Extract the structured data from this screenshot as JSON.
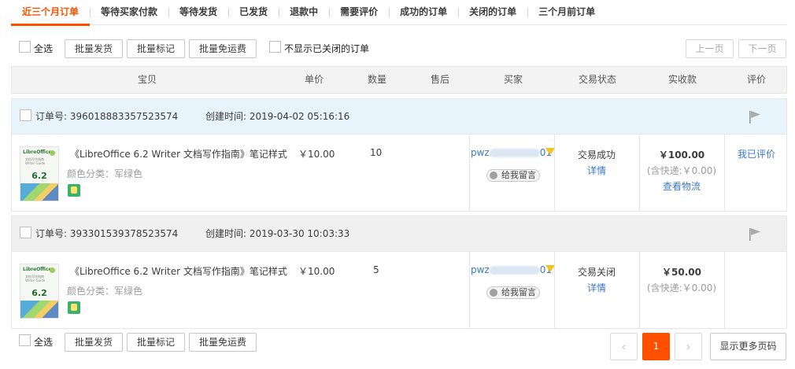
{
  "tabs": [
    {
      "label": "近三个月订单",
      "active": true
    },
    {
      "label": "等待买家付款"
    },
    {
      "label": "等待发货"
    },
    {
      "label": "已发货"
    },
    {
      "label": "退款中"
    },
    {
      "label": "需要评价"
    },
    {
      "label": "成功的订单"
    },
    {
      "label": "关闭的订单"
    },
    {
      "label": "三个月前订单"
    }
  ],
  "toolbar": {
    "select_all": "全选",
    "bulk_ship": "批量发货",
    "bulk_mark": "批量标记",
    "bulk_free_shipping": "批量免运费",
    "hide_closed": "不显示已关闭的订单",
    "prev_page": "上一页",
    "next_page": "下一页"
  },
  "columns": [
    "宝贝",
    "单价",
    "数量",
    "售后",
    "买家",
    "交易状态",
    "实收款",
    "评价"
  ],
  "orders": [
    {
      "order_no": "订单号: 396018883357523574",
      "created": "创建时间: 2019-04-02 05:16:16",
      "item_title": "《LibreOffice 6.2 Writer 文档写作指南》笔记样式",
      "sku": "颜色分类：军绿色",
      "price": "￥10.00",
      "qty": "10",
      "buyer_start": "pwz",
      "buyer_end": "01",
      "message": "给我留言",
      "status": "交易成功",
      "detail": "详情",
      "amount": "￥100.00",
      "shipping": "(含快递:￥0.00)",
      "logistics": "查看物流",
      "rating": "我已评价",
      "header_bg": "#e8f4fb"
    },
    {
      "order_no": "订单号: 393301539378523574",
      "created": "创建时间: 2019-03-30 10:03:33",
      "item_title": "《LibreOffice 6.2 Writer 文档写作指南》笔记样式",
      "sku": "颜色分类：军绿色",
      "price": "￥10.00",
      "qty": "5",
      "buyer_start": "pwz",
      "buyer_end": "01",
      "message": "给我留言",
      "status": "交易关闭",
      "detail": "详情",
      "amount": "￥50.00",
      "shipping": "(含快递:￥0.00)",
      "logistics": "",
      "rating": "",
      "header_bg": "#f0f0f0"
    }
  ],
  "thumb": {
    "logo": "LibreOffice",
    "version": "6.2",
    "subtitle": "文档写作指南 Writer Guide"
  },
  "pagination": {
    "current": "1",
    "more": "显示更多页码",
    "prev": "‹",
    "next": "›"
  },
  "colors": {
    "accent": "#ff5000",
    "link": "#3c78c8"
  }
}
